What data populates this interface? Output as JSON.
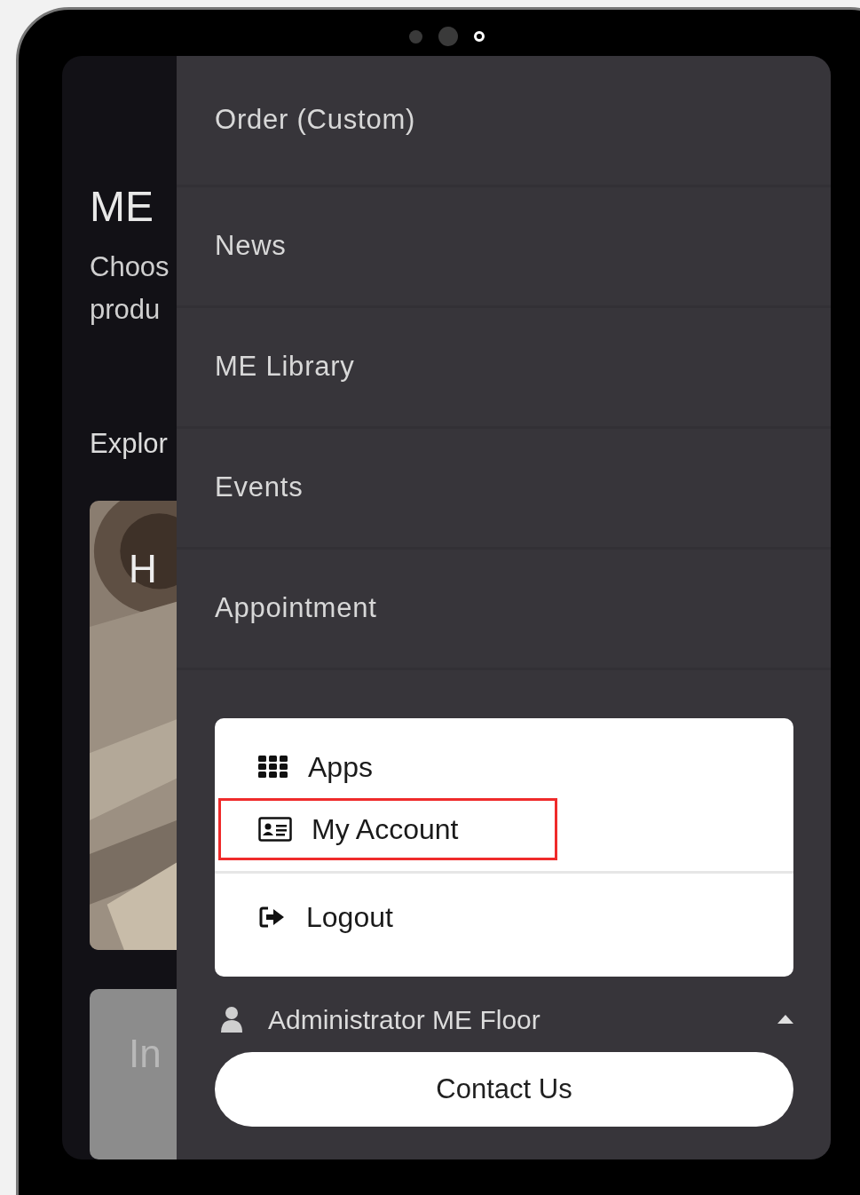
{
  "background_page": {
    "title": "ME",
    "subtitle_lines": [
      "Choos",
      "produ"
    ],
    "section_label": "Explor",
    "cards": [
      {
        "kind": "picture",
        "label": "H"
      },
      {
        "kind": "plain",
        "label": "In"
      }
    ]
  },
  "nav_menu": {
    "items": [
      {
        "label": "Order (Custom)"
      },
      {
        "label": "News"
      },
      {
        "label": "ME Library"
      },
      {
        "label": "Events"
      },
      {
        "label": "Appointment"
      }
    ]
  },
  "account_menu": {
    "expanded": true,
    "items": [
      {
        "kind": "apps",
        "label": "Apps",
        "highlighted": false
      },
      {
        "kind": "account",
        "label": "My Account",
        "highlighted": true
      },
      {
        "kind": "logout",
        "label": "Logout",
        "highlighted": false
      }
    ]
  },
  "user": {
    "name": "Administrator ME Floor"
  },
  "contact_button": {
    "label": "Contact Us"
  }
}
